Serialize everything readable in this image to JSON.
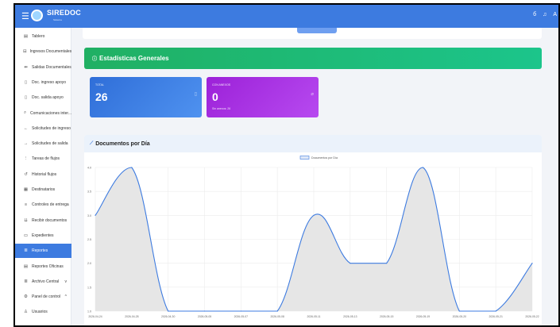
{
  "app": {
    "brand": "SIREDOC",
    "brand_sub": "Sistema"
  },
  "topbar": {
    "icons": [
      "bell-icon",
      "notification-icon",
      "user-icon"
    ]
  },
  "sidebar": {
    "items": [
      {
        "label": "Tablero",
        "icon": "table-icon",
        "active": false
      },
      {
        "label": "Ingresos Documentales",
        "icon": "inbox-icon",
        "active": false
      },
      {
        "label": "Salidas Documentales",
        "icon": "send-icon",
        "active": false
      },
      {
        "label": "Doc. ingreso apoyo",
        "icon": "document-icon",
        "active": false
      },
      {
        "label": "Doc. salida apoyo",
        "icon": "document-out-icon",
        "active": false
      },
      {
        "label": "Comunicaciones inter...",
        "icon": "chat-icon",
        "active": false
      },
      {
        "label": "Solicitudes de ingreso",
        "icon": "arrow-left-icon",
        "active": false
      },
      {
        "label": "Solicitudes de salida",
        "icon": "arrow-right-icon",
        "active": false
      },
      {
        "label": "Tareas de flujos",
        "icon": "flow-icon",
        "active": false
      },
      {
        "label": "Historial flujos",
        "icon": "history-icon",
        "active": false
      },
      {
        "label": "Destinatarios",
        "icon": "users-list-icon",
        "active": false
      },
      {
        "label": "Controles de entrega",
        "icon": "list-icon",
        "active": false
      },
      {
        "label": "Recibir documentos",
        "icon": "receive-icon",
        "active": false
      },
      {
        "label": "Expedientes",
        "icon": "folder-icon",
        "active": false
      },
      {
        "label": "Reportes",
        "icon": "report-icon",
        "active": true
      },
      {
        "label": "Reportes Oficinas",
        "icon": "report-office-icon",
        "active": false
      },
      {
        "label": "Archivo Central",
        "icon": "archive-icon",
        "active": false,
        "chevron": "v"
      },
      {
        "label": "Panel de control",
        "icon": "gear-icon",
        "active": false,
        "chevron": "^"
      },
      {
        "label": "Usuarios",
        "icon": "user-icon",
        "active": false
      }
    ]
  },
  "stats": {
    "title": "Estadísticas Generales",
    "cards": [
      {
        "label": "TOTAL",
        "value": "26",
        "sub": "",
        "color": "#3d7be0"
      },
      {
        "label": "CON ANEXOS",
        "value": "0",
        "sub": "Sin anexos: 26",
        "color": "#a92ee0"
      }
    ]
  },
  "chart_panel": {
    "title": "Documentos por Día"
  },
  "chart_data": {
    "type": "area",
    "legend": "Documentos por Día",
    "legend_position": "top-center",
    "categories": [
      "2026-04-24",
      "2026-04-28",
      "2026-04-30",
      "2026-05-05",
      "2026-05-07",
      "2026-05-08",
      "2026-05-11",
      "2026-05-13",
      "2026-05-15",
      "2026-05-19",
      "2026-05-20",
      "2026-05-21",
      "2026-05-22"
    ],
    "values": [
      3.0,
      4.0,
      1.0,
      1.0,
      1.0,
      1.0,
      3.0,
      2.0,
      2.0,
      4.0,
      1.0,
      1.0,
      2.0
    ],
    "yticks": [
      "1.0",
      "1.5",
      "2.0",
      "2.5",
      "3.0",
      "3.5",
      "4.0"
    ],
    "ylim": [
      1.0,
      4.0
    ],
    "line_color": "#3d7be0",
    "fill_color": "#e6e6e6",
    "grid": true
  }
}
